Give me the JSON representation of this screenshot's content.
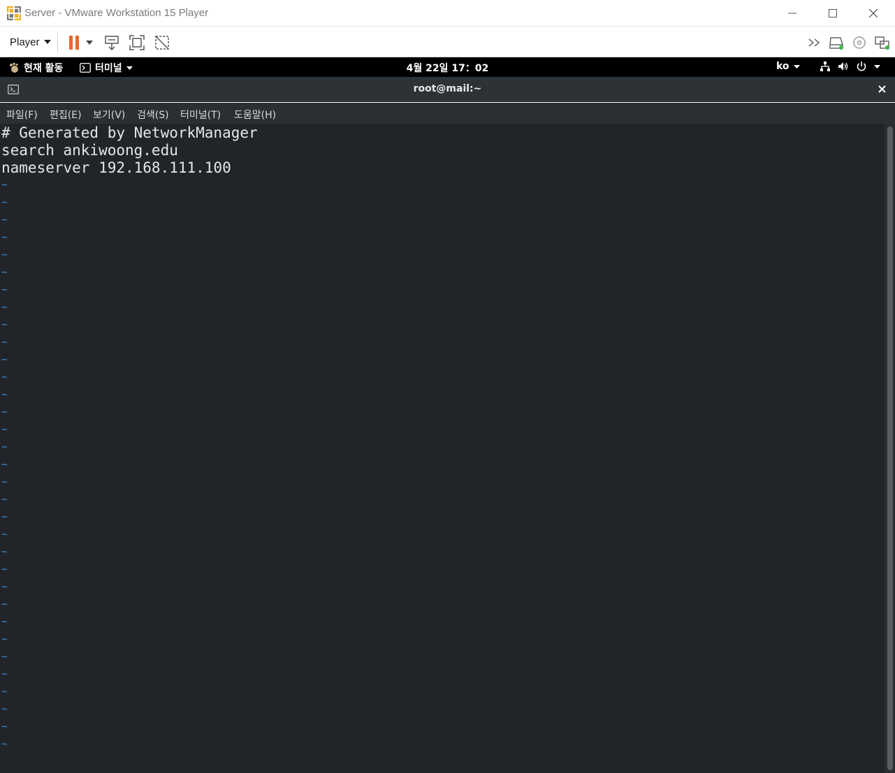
{
  "window": {
    "title": "Server - VMware Workstation 15 Player",
    "controls": [
      "minimize",
      "maximize",
      "close"
    ]
  },
  "vm_toolbar": {
    "player_label": "Player",
    "icons": [
      "pause-icon",
      "send-ctrl-alt-del-icon",
      "full-screen-icon",
      "unity-icon",
      "more-icon",
      "disk-icon",
      "cd-icon",
      "network-adapter-icon"
    ]
  },
  "gnome_bar": {
    "activities_label": "현재 활동",
    "app_menu_label": "터미널",
    "clock": "4월 22일  17：02",
    "keyboard_layout": "ko"
  },
  "terminal": {
    "title": "root@mail:~",
    "menu": [
      "파일(F)",
      "편집(E)",
      "보기(V)",
      "검색(S)",
      "터미널(T)",
      "도움말(H)"
    ],
    "lines": [
      "# Generated by NetworkManager",
      "search ankiwoong.edu",
      "nameserver 192.168.111.100"
    ],
    "empty_marker": "~",
    "empty_marker_count": 33
  },
  "colors": {
    "accent_pause": "#e8692d",
    "terminal_bg": "#212529",
    "tilde": "#3d8fd6"
  }
}
